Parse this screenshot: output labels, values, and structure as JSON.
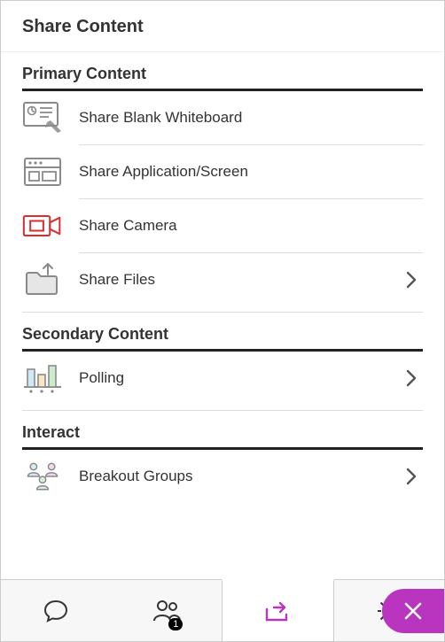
{
  "header": {
    "title": "Share Content"
  },
  "sections": {
    "primary": {
      "title": "Primary Content",
      "items": [
        {
          "label": "Share Blank Whiteboard"
        },
        {
          "label": "Share Application/Screen"
        },
        {
          "label": "Share Camera"
        },
        {
          "label": "Share Files"
        }
      ]
    },
    "secondary": {
      "title": "Secondary Content",
      "items": [
        {
          "label": "Polling"
        }
      ]
    },
    "interact": {
      "title": "Interact",
      "items": [
        {
          "label": "Breakout Groups"
        }
      ]
    }
  },
  "bottombar": {
    "badge_count": "1"
  },
  "colors": {
    "accent_purple": "#b935c0",
    "camera_red": "#d9302f",
    "icon_grey": "#8a8a8a"
  }
}
